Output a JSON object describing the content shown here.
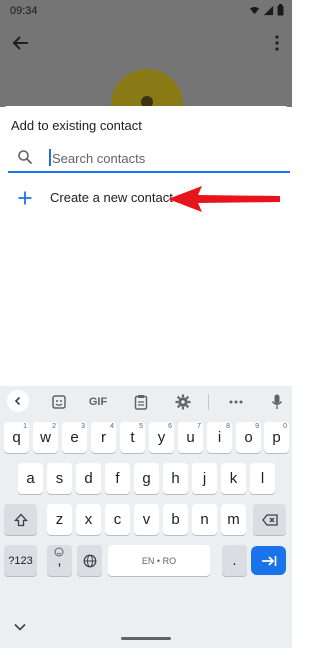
{
  "status_bar": {
    "time": "09:34"
  },
  "sheet": {
    "title": "Add to existing contact",
    "search_placeholder": "Search contacts",
    "create_label": "Create a new contact"
  },
  "keyboard": {
    "toolbar": {
      "gif_label": "GIF"
    },
    "rows": [
      [
        {
          "k": "q",
          "h": "1"
        },
        {
          "k": "w",
          "h": "2"
        },
        {
          "k": "e",
          "h": "3"
        },
        {
          "k": "r",
          "h": "4"
        },
        {
          "k": "t",
          "h": "5"
        },
        {
          "k": "y",
          "h": "6"
        },
        {
          "k": "u",
          "h": "7"
        },
        {
          "k": "i",
          "h": "8"
        },
        {
          "k": "o",
          "h": "9"
        },
        {
          "k": "p",
          "h": "0"
        }
      ],
      [
        {
          "k": "a"
        },
        {
          "k": "s"
        },
        {
          "k": "d"
        },
        {
          "k": "f"
        },
        {
          "k": "g"
        },
        {
          "k": "h"
        },
        {
          "k": "j"
        },
        {
          "k": "k"
        },
        {
          "k": "l"
        }
      ],
      [
        {
          "k": "z"
        },
        {
          "k": "x"
        },
        {
          "k": "c"
        },
        {
          "k": "v"
        },
        {
          "k": "b"
        },
        {
          "k": "n"
        },
        {
          "k": "m"
        }
      ]
    ],
    "symbols_label": "?123",
    "comma_label": ",",
    "period_label": ".",
    "space_label": "EN • RO"
  },
  "colors": {
    "accent": "#1a73e8",
    "annotation_arrow": "#e8141b",
    "scrim": "#757575"
  }
}
